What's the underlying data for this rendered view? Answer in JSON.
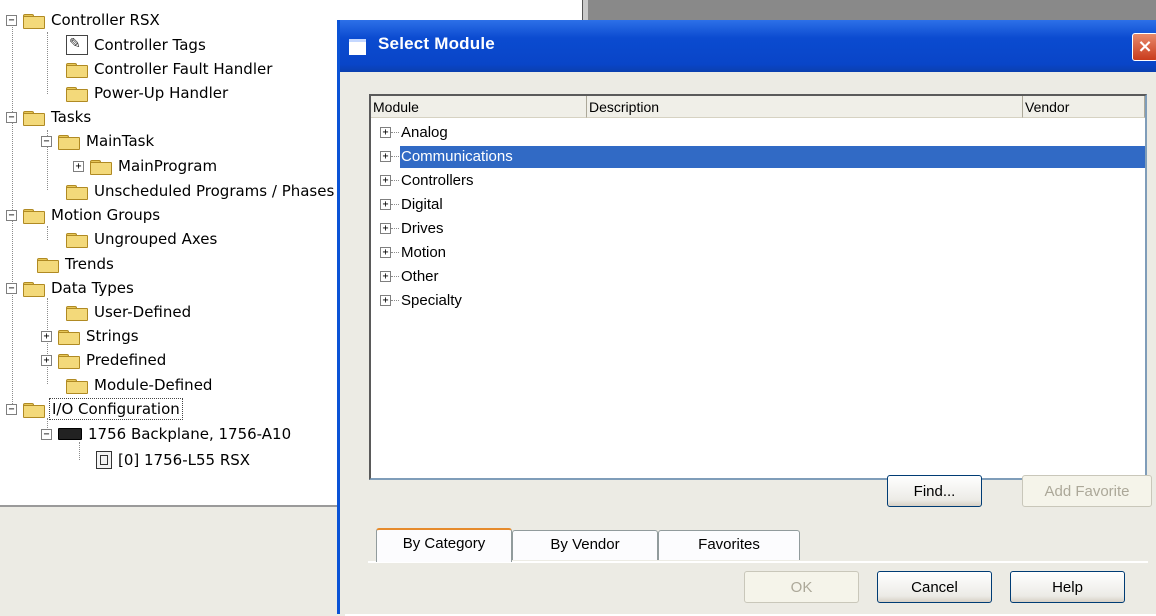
{
  "tree": {
    "nodes": [
      {
        "id": "controller",
        "label": "Controller RSX"
      },
      {
        "id": "controller-tags",
        "label": "Controller Tags"
      },
      {
        "id": "fault-handler",
        "label": "Controller Fault Handler"
      },
      {
        "id": "powerup-handler",
        "label": "Power-Up Handler"
      },
      {
        "id": "tasks",
        "label": "Tasks"
      },
      {
        "id": "maintask",
        "label": "MainTask"
      },
      {
        "id": "mainprogram",
        "label": "MainProgram"
      },
      {
        "id": "unscheduled",
        "label": "Unscheduled Programs / Phases"
      },
      {
        "id": "motion-groups",
        "label": "Motion Groups"
      },
      {
        "id": "ungrouped-axes",
        "label": "Ungrouped Axes"
      },
      {
        "id": "trends",
        "label": "Trends"
      },
      {
        "id": "data-types",
        "label": "Data Types"
      },
      {
        "id": "user-defined",
        "label": "User-Defined"
      },
      {
        "id": "strings",
        "label": "Strings"
      },
      {
        "id": "predefined",
        "label": "Predefined"
      },
      {
        "id": "module-defined",
        "label": "Module-Defined"
      },
      {
        "id": "io-config",
        "label": "I/O Configuration"
      },
      {
        "id": "backplane",
        "label": "1756 Backplane, 1756-A10"
      },
      {
        "id": "slot0",
        "label": "[0] 1756-L55 RSX"
      }
    ]
  },
  "dialog": {
    "title": "Select Module",
    "close_label": "×",
    "columns": {
      "module": "Module",
      "description": "Description",
      "vendor": "Vendor"
    },
    "categories": [
      "Analog",
      "Communications",
      "Controllers",
      "Digital",
      "Drives",
      "Motion",
      "Other",
      "Specialty"
    ],
    "selected_category": "Communications",
    "buttons": {
      "find": "Find...",
      "add_favorite": "Add Favorite",
      "ok": "OK",
      "cancel": "Cancel",
      "help": "Help"
    },
    "tabs": [
      "By Category",
      "By Vendor",
      "Favorites"
    ],
    "active_tab": "By Category"
  },
  "colors": {
    "selection": "#316ac5",
    "titlebar": "#0b4bd0",
    "close": "#c93b1c"
  }
}
